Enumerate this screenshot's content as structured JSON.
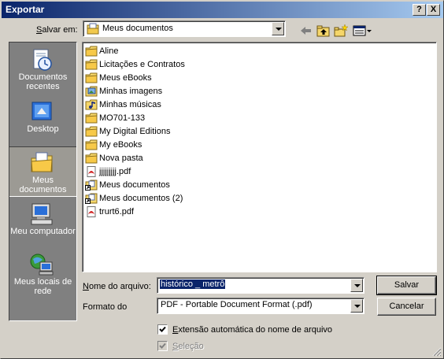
{
  "window": {
    "title": "Exportar",
    "help_label": "?",
    "close_label": "X"
  },
  "save_in": {
    "label_prefix": "S",
    "label_rest": "alvar em:",
    "value": "Meus documentos"
  },
  "places": [
    {
      "label": "Documentos recentes",
      "icon": "recent-documents-icon"
    },
    {
      "label": "Desktop",
      "icon": "desktop-icon"
    },
    {
      "label": "Meus documentos",
      "icon": "my-documents-icon",
      "selected": true
    },
    {
      "label": "Meu computador",
      "icon": "my-computer-icon"
    },
    {
      "label": "Meus locais de rede",
      "icon": "network-places-icon"
    }
  ],
  "files": [
    {
      "name": "Aline",
      "type": "folder"
    },
    {
      "name": "Licitações e Contratos",
      "type": "folder"
    },
    {
      "name": "Meus eBooks",
      "type": "folder"
    },
    {
      "name": "Minhas imagens",
      "type": "folder-pictures"
    },
    {
      "name": "Minhas músicas",
      "type": "folder-music"
    },
    {
      "name": "MO701-133",
      "type": "folder"
    },
    {
      "name": "My Digital Editions",
      "type": "folder"
    },
    {
      "name": "My eBooks",
      "type": "folder"
    },
    {
      "name": "Nova pasta",
      "type": "folder"
    },
    {
      "name": "jjjjjjjjj.pdf",
      "type": "pdf"
    },
    {
      "name": "Meus documentos",
      "type": "shortcut"
    },
    {
      "name": "Meus documentos (2)",
      "type": "shortcut"
    },
    {
      "name": "trurt6.pdf",
      "type": "pdf"
    }
  ],
  "filename": {
    "label_prefix": "N",
    "label_rest": "ome do arquivo:",
    "value": "histórico _ metrô"
  },
  "format": {
    "label": "Formato do",
    "value": "PDF - Portable Document Format (.pdf)"
  },
  "buttons": {
    "save": "Salvar",
    "cancel": "Cancelar"
  },
  "options": {
    "auto_extension": {
      "label_prefix": "E",
      "label_rest": "xtensão automática do nome de arquivo",
      "checked": true
    },
    "selection": {
      "label_prefix": "S",
      "label_rest": "eleção",
      "checked": true,
      "disabled": true
    }
  },
  "colors": {
    "title_gradient_start": "#0a246a",
    "title_gradient_end": "#a6caf0",
    "face": "#d4d0c8",
    "selection": "#0a246a",
    "folder_yellow": "#f5d66a"
  }
}
